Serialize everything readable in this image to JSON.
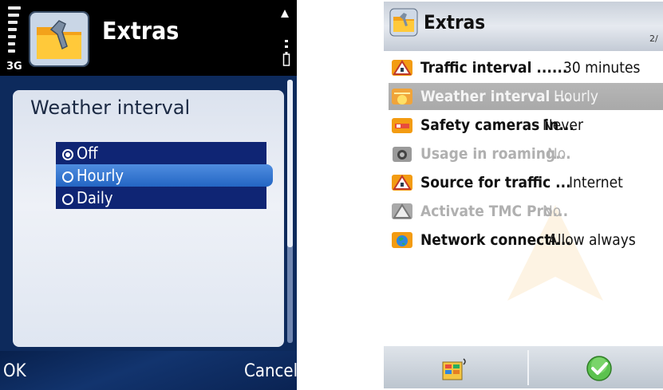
{
  "left": {
    "network_type": "3G",
    "app_title": "Extras",
    "dialog_title": "Weather interval",
    "options": [
      {
        "label": "Off",
        "checked": true,
        "highlighted": false
      },
      {
        "label": "Hourly",
        "checked": false,
        "highlighted": true
      },
      {
        "label": "Daily",
        "checked": false,
        "highlighted": false
      }
    ],
    "softkeys": {
      "left": "OK",
      "right": "Cancel"
    }
  },
  "right": {
    "app_title": "Extras",
    "page_indicator": "2/",
    "rows": [
      {
        "label": "Traffic interval ......",
        "value": "30 minutes",
        "icon": "traffic-warning-icon",
        "state": "normal"
      },
      {
        "label": "Weather interval ...",
        "value": "Hourly",
        "icon": "weather-sun-icon",
        "state": "highlighted"
      },
      {
        "label": "Safety cameras in...",
        "value": "Never",
        "icon": "safety-camera-icon",
        "state": "normal"
      },
      {
        "label": "Usage in roaming...",
        "value": "No",
        "icon": "roaming-icon",
        "state": "disabled"
      },
      {
        "label": "Source for traffic ...",
        "value": "Internet",
        "icon": "traffic-source-icon",
        "state": "normal"
      },
      {
        "label": "Activate TMC Pro...",
        "value": "No",
        "icon": "tmc-icon",
        "state": "disabled"
      },
      {
        "label": "Network connecti...",
        "value": "Allow always",
        "icon": "globe-icon",
        "state": "normal"
      }
    ]
  },
  "colors": {
    "left_background": "#0d2a5c",
    "option_background": "#0f2574",
    "option_highlight": "#3a7ad6",
    "right_highlight": "#a9a9a9"
  }
}
